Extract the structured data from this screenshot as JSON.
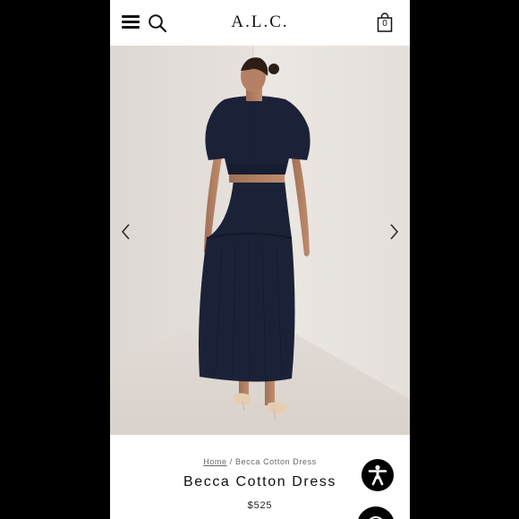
{
  "header": {
    "brand": "A.L.C.",
    "bag_count": "0",
    "menu_icon": "hamburger-menu-icon",
    "search_icon": "search-icon",
    "bag_icon": "shopping-bag-icon"
  },
  "gallery": {
    "prev_icon": "chevron-left-icon",
    "next_icon": "chevron-right-icon"
  },
  "breadcrumb": {
    "home": "Home",
    "separator": "/",
    "current": "Becca Cotton Dress"
  },
  "product": {
    "title": "Becca Cotton Dress",
    "price": "$525"
  },
  "colors": {
    "background": "#000000",
    "dress_navy": "#1b2238",
    "wall": "#e7e2dd"
  }
}
